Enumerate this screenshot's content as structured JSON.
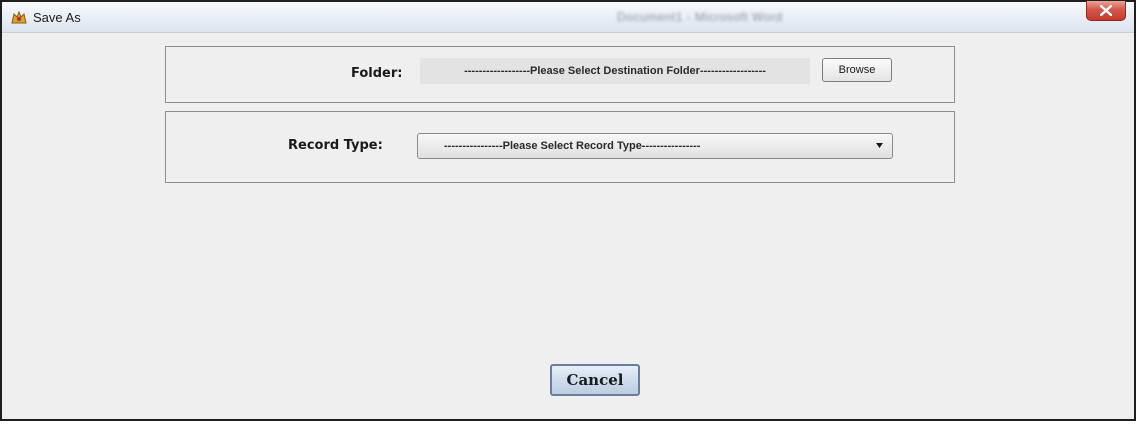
{
  "window": {
    "title": "Save As",
    "background_title": "Document1 - Microsoft Word",
    "app_icon": "app-logo-icon",
    "close_icon": "close-icon"
  },
  "folder": {
    "label": "Folder:",
    "value": "------------------Please Select Destination Folder------------------",
    "browse_label": "Browse"
  },
  "record_type": {
    "label": "Record Type:",
    "selected": "----------------Please Select Record Type----------------",
    "dropdown_icon": "chevron-down-icon"
  },
  "actions": {
    "cancel_label": "Cancel"
  },
  "colors": {
    "window_bg": "#efefef",
    "close_button": "#c43a2c",
    "cancel_button": "#cddbec"
  }
}
